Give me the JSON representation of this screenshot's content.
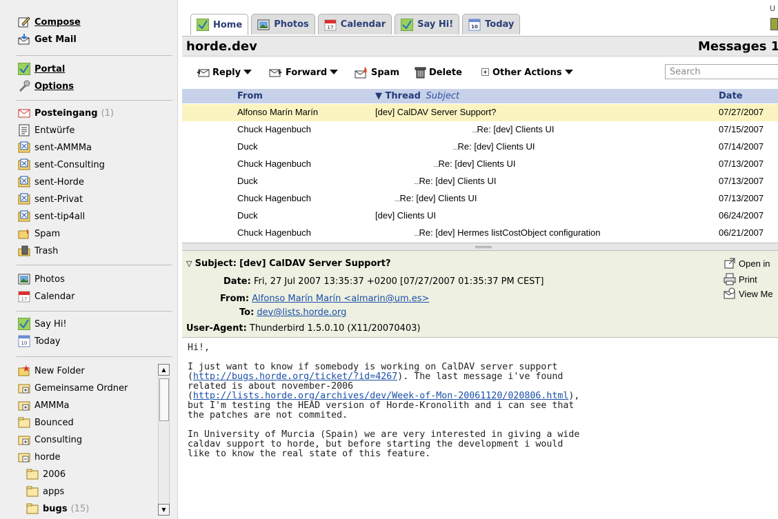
{
  "sidebar": {
    "compose": "Compose",
    "get_mail": "Get Mail",
    "portal": "Portal",
    "options": "Options",
    "folders": [
      {
        "label": "Posteingang",
        "count": "(1)",
        "icon": "inbox-icon"
      },
      {
        "label": "Entwürfe",
        "icon": "drafts-icon"
      },
      {
        "label": "sent-AMMMa",
        "icon": "sent-folder-icon"
      },
      {
        "label": "sent-Consulting",
        "icon": "sent-folder-icon"
      },
      {
        "label": "sent-Horde",
        "icon": "sent-folder-icon"
      },
      {
        "label": "sent-Privat",
        "icon": "sent-folder-icon"
      },
      {
        "label": "sent-tip4all",
        "icon": "sent-folder-icon"
      },
      {
        "label": "Spam",
        "icon": "spam-folder-icon"
      },
      {
        "label": "Trash",
        "icon": "trash-icon"
      }
    ],
    "apps": [
      {
        "label": "Photos",
        "icon": "photos-icon"
      },
      {
        "label": "Calendar",
        "icon": "calendar-icon"
      },
      {
        "label": "Say Hi!",
        "icon": "sayhi-icon"
      },
      {
        "label": "Today",
        "icon": "today-icon"
      }
    ],
    "tree": [
      {
        "label": "New Folder",
        "icon": "new-folder-icon"
      },
      {
        "label": "Gemeinsame Ordner",
        "icon": "folder-expand-icon"
      },
      {
        "label": "AMMMa",
        "icon": "folder-expand-icon"
      },
      {
        "label": "Bounced",
        "icon": "folder-icon"
      },
      {
        "label": "Consulting",
        "icon": "folder-expand-icon"
      },
      {
        "label": "horde",
        "icon": "folder-collapse-icon"
      },
      {
        "label": "2006",
        "icon": "folder-icon"
      },
      {
        "label": "apps",
        "icon": "folder-icon"
      },
      {
        "label": "bugs",
        "count": "(15)",
        "icon": "folder-icon"
      }
    ]
  },
  "tabs": [
    "Home",
    "Photos",
    "Calendar",
    "Say Hi!",
    "Today"
  ],
  "header": {
    "mailbox": "horde.dev",
    "right_title": "Messages 1",
    "corner_text": "U"
  },
  "toolbar": {
    "reply": "Reply",
    "forward": "Forward",
    "spam": "Spam",
    "delete": "Delete",
    "other": "Other Actions",
    "search_placeholder": "Search"
  },
  "list": {
    "col_from": "From",
    "col_thread": "Thread",
    "col_subject": "Subject",
    "col_date": "Date",
    "rows": [
      {
        "from": "Alfonso Marín Marín",
        "subject": "[dev] CalDAV Server Support?",
        "date": "07/27/2007",
        "indent": 0
      },
      {
        "from": "Chuck Hagenbuch",
        "subject": "Re: [dev] Clients UI",
        "date": "07/15/2007",
        "indent": 5
      },
      {
        "from": "Duck",
        "subject": "Re: [dev] Clients UI",
        "date": "07/14/2007",
        "indent": 4
      },
      {
        "from": "Chuck Hagenbuch",
        "subject": "Re: [dev] Clients UI",
        "date": "07/13/2007",
        "indent": 3
      },
      {
        "from": "Duck",
        "subject": "Re: [dev] Clients UI",
        "date": "07/13/2007",
        "indent": 2
      },
      {
        "from": "Chuck Hagenbuch",
        "subject": "Re: [dev] Clients UI",
        "date": "07/13/2007",
        "indent": 1
      },
      {
        "from": "Duck",
        "subject": "[dev] Clients UI",
        "date": "06/24/2007",
        "indent": 0
      },
      {
        "from": "Chuck Hagenbuch",
        "subject": "Re: [dev] Hermes listCostObject configuration",
        "date": "06/21/2007",
        "indent": 2
      }
    ]
  },
  "preview": {
    "subject_label": "Subject:",
    "subject": "[dev] CalDAV Server Support?",
    "date_label": "Date:",
    "date": "Fri, 27 Jul 2007 13:35:37 +0200 [07/27/2007 01:35:37 PM CEST]",
    "from_label": "From:",
    "from": "Alfonso Marín Marín <almarin@um.es>",
    "to_label": "To:",
    "to": "dev@lists.horde.org",
    "ua_label": "User-Agent:",
    "ua": "Thunderbird 1.5.0.10 (X11/20070403)",
    "actions": [
      "Open in",
      "Print",
      "View Me"
    ]
  },
  "body": {
    "greeting": "Hi!,",
    "p1": [
      "I just want to know if somebody is working on CalDAV server support",
      "related is about november-2006",
      "but I'm testing the HEAD version of Horde-Kronolith and i can see that",
      "the patches are not commited."
    ],
    "link1": "http://bugs.horde.org/ticket/?id=4267",
    "link1_tail": ". The last message i've found",
    "link2": "http://lists.horde.org/archives/dev/Week-of-Mon-20061120/020806.html",
    "p2": [
      "In University of Murcia (Spain) we are very interested in giving a wide",
      "caldav support to horde, but before starting the development i would",
      "like to know the real state of this feature."
    ]
  }
}
